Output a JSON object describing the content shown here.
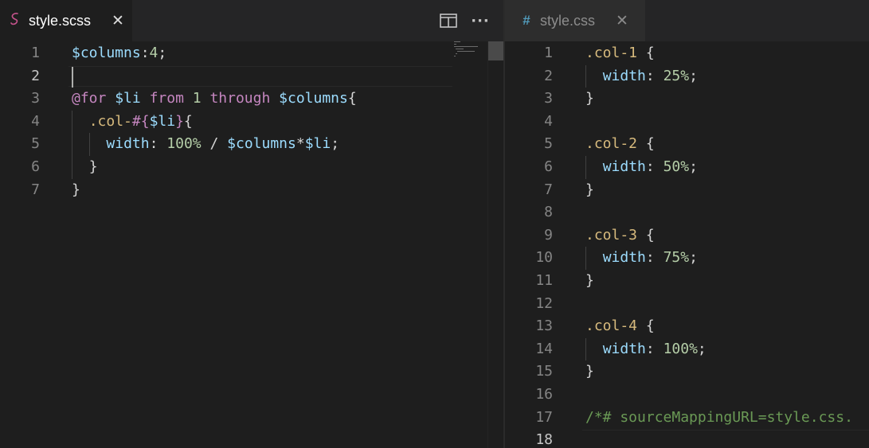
{
  "colors": {
    "background": "#1e1e1e",
    "tabbar": "#252526",
    "scss_icon": "#c6538c",
    "css_icon": "#519aba"
  },
  "left_tab": {
    "title": "style.scss",
    "icon": "sass-file-icon",
    "close_glyph": "✕"
  },
  "right_tab": {
    "title": "style.css",
    "icon": "css-file-icon",
    "icon_glyph": "#",
    "close_glyph": "✕"
  },
  "toolbar": {
    "split_icon": "split-editor-icon",
    "more_glyph": "···"
  },
  "left_editor": {
    "current_line": 2,
    "lines": [
      {
        "n": "1",
        "indent": 0,
        "tokens": [
          {
            "t": "$columns",
            "c": "var"
          },
          {
            "t": ":",
            "c": "plain"
          },
          {
            "t": "4",
            "c": "num"
          },
          {
            "t": ";",
            "c": "plain"
          }
        ]
      },
      {
        "n": "2",
        "indent": 0,
        "tokens": []
      },
      {
        "n": "3",
        "indent": 0,
        "tokens": [
          {
            "t": "@for",
            "c": "kw"
          },
          {
            "t": " ",
            "c": "plain"
          },
          {
            "t": "$li",
            "c": "var"
          },
          {
            "t": " ",
            "c": "plain"
          },
          {
            "t": "from",
            "c": "kw"
          },
          {
            "t": " ",
            "c": "plain"
          },
          {
            "t": "1",
            "c": "num"
          },
          {
            "t": " ",
            "c": "plain"
          },
          {
            "t": "through",
            "c": "kw"
          },
          {
            "t": " ",
            "c": "plain"
          },
          {
            "t": "$columns",
            "c": "var"
          },
          {
            "t": "{",
            "c": "plain"
          }
        ]
      },
      {
        "n": "4",
        "indent": 1,
        "tokens": [
          {
            "t": ".col-",
            "c": "sel"
          },
          {
            "t": "#{",
            "c": "kw"
          },
          {
            "t": "$li",
            "c": "var"
          },
          {
            "t": "}",
            "c": "kw"
          },
          {
            "t": "{",
            "c": "plain"
          }
        ]
      },
      {
        "n": "5",
        "indent": 2,
        "tokens": [
          {
            "t": "width",
            "c": "prop"
          },
          {
            "t": ": ",
            "c": "plain"
          },
          {
            "t": "100%",
            "c": "num"
          },
          {
            "t": " / ",
            "c": "plain"
          },
          {
            "t": "$columns",
            "c": "var"
          },
          {
            "t": "*",
            "c": "plain"
          },
          {
            "t": "$li",
            "c": "var"
          },
          {
            "t": ";",
            "c": "plain"
          }
        ]
      },
      {
        "n": "6",
        "indent": 1,
        "tokens": [
          {
            "t": "}",
            "c": "plain"
          }
        ]
      },
      {
        "n": "7",
        "indent": 0,
        "tokens": [
          {
            "t": "}",
            "c": "plain"
          }
        ]
      }
    ]
  },
  "right_editor": {
    "current_line": 18,
    "lines": [
      {
        "n": "1",
        "indent": 0,
        "tokens": [
          {
            "t": ".col-1",
            "c": "sel"
          },
          {
            "t": " {",
            "c": "plain"
          }
        ]
      },
      {
        "n": "2",
        "indent": 1,
        "tokens": [
          {
            "t": "width",
            "c": "prop"
          },
          {
            "t": ": ",
            "c": "plain"
          },
          {
            "t": "25%",
            "c": "num"
          },
          {
            "t": ";",
            "c": "plain"
          }
        ]
      },
      {
        "n": "3",
        "indent": 0,
        "tokens": [
          {
            "t": "}",
            "c": "plain"
          }
        ]
      },
      {
        "n": "4",
        "indent": 0,
        "tokens": []
      },
      {
        "n": "5",
        "indent": 0,
        "tokens": [
          {
            "t": ".col-2",
            "c": "sel"
          },
          {
            "t": " {",
            "c": "plain"
          }
        ]
      },
      {
        "n": "6",
        "indent": 1,
        "tokens": [
          {
            "t": "width",
            "c": "prop"
          },
          {
            "t": ": ",
            "c": "plain"
          },
          {
            "t": "50%",
            "c": "num"
          },
          {
            "t": ";",
            "c": "plain"
          }
        ]
      },
      {
        "n": "7",
        "indent": 0,
        "tokens": [
          {
            "t": "}",
            "c": "plain"
          }
        ]
      },
      {
        "n": "8",
        "indent": 0,
        "tokens": []
      },
      {
        "n": "9",
        "indent": 0,
        "tokens": [
          {
            "t": ".col-3",
            "c": "sel"
          },
          {
            "t": " {",
            "c": "plain"
          }
        ]
      },
      {
        "n": "10",
        "indent": 1,
        "tokens": [
          {
            "t": "width",
            "c": "prop"
          },
          {
            "t": ": ",
            "c": "plain"
          },
          {
            "t": "75%",
            "c": "num"
          },
          {
            "t": ";",
            "c": "plain"
          }
        ]
      },
      {
        "n": "11",
        "indent": 0,
        "tokens": [
          {
            "t": "}",
            "c": "plain"
          }
        ]
      },
      {
        "n": "12",
        "indent": 0,
        "tokens": []
      },
      {
        "n": "13",
        "indent": 0,
        "tokens": [
          {
            "t": ".col-4",
            "c": "sel"
          },
          {
            "t": " {",
            "c": "plain"
          }
        ]
      },
      {
        "n": "14",
        "indent": 1,
        "tokens": [
          {
            "t": "width",
            "c": "prop"
          },
          {
            "t": ": ",
            "c": "plain"
          },
          {
            "t": "100%",
            "c": "num"
          },
          {
            "t": ";",
            "c": "plain"
          }
        ]
      },
      {
        "n": "15",
        "indent": 0,
        "tokens": [
          {
            "t": "}",
            "c": "plain"
          }
        ]
      },
      {
        "n": "16",
        "indent": 0,
        "tokens": []
      },
      {
        "n": "17",
        "indent": 0,
        "tokens": [
          {
            "t": "/*# sourceMappingURL=style.css.",
            "c": "comment"
          }
        ]
      },
      {
        "n": "18",
        "indent": 0,
        "tokens": []
      }
    ]
  }
}
